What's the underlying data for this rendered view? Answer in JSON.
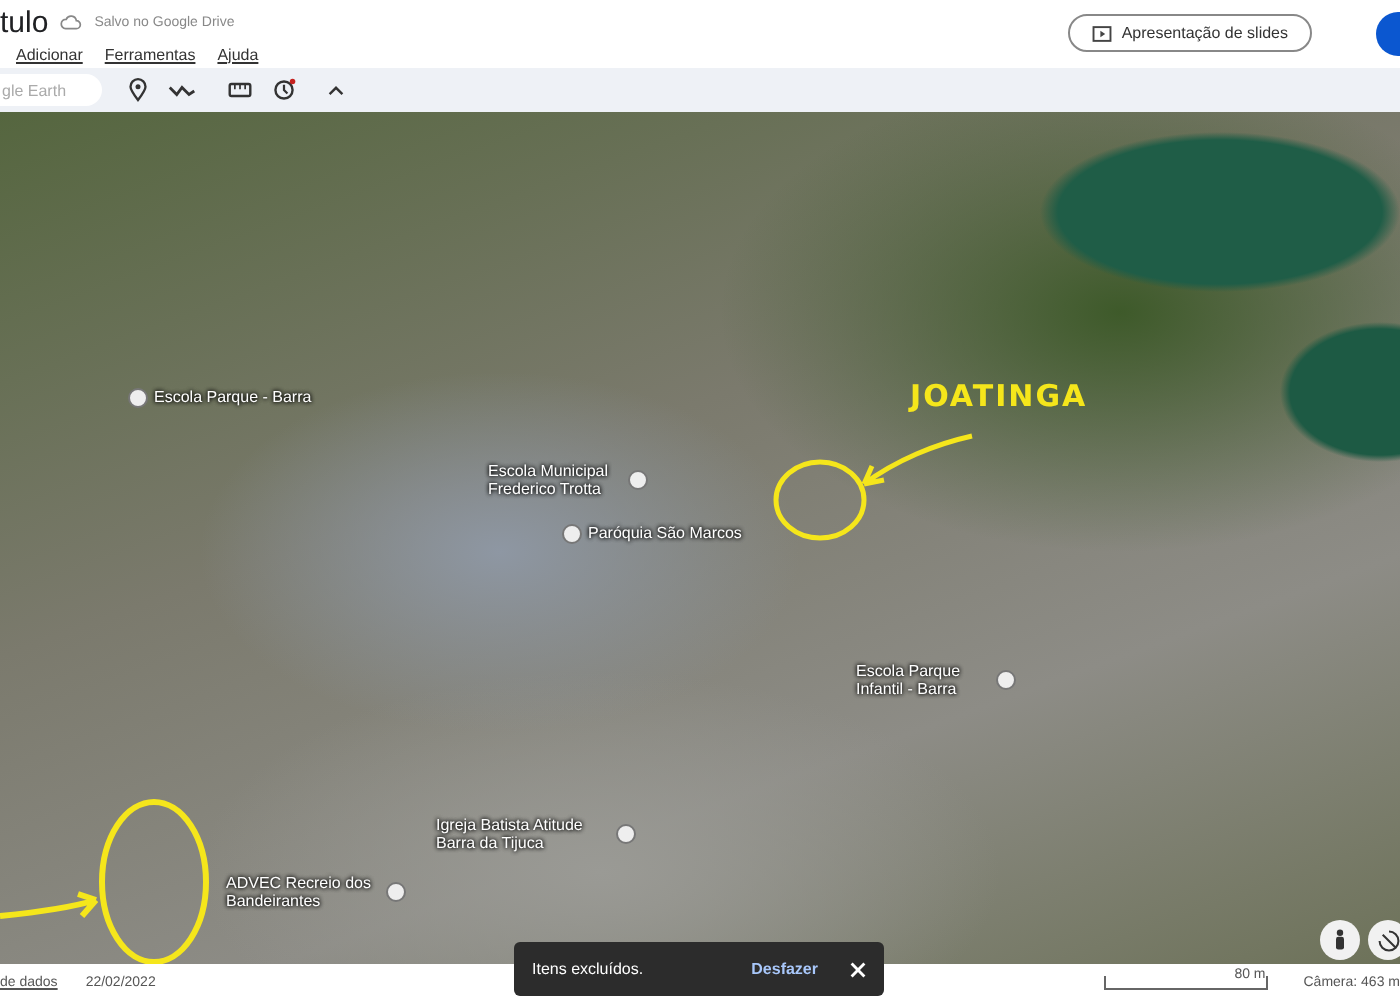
{
  "document": {
    "title": "tulo",
    "save_status": "Salvo no Google Drive"
  },
  "menu": [
    "Adicionar",
    "Ferramentas",
    "Ajuda"
  ],
  "search": {
    "placeholder": "gle Earth"
  },
  "slideshow_button": {
    "label": "Apresentação de slides"
  },
  "map": {
    "labels": [
      {
        "text": "Escola Parque - Barra"
      },
      {
        "text": "Escola Municipal Frederico Trotta"
      },
      {
        "text": "Paróquia São Marcos"
      },
      {
        "text": "Escola Parque Infantil - Barra"
      },
      {
        "text": "Igreja Batista Atitude Barra da Tijuca"
      },
      {
        "text": "ADVEC Recreio dos Bandeirantes"
      }
    ],
    "annotation": "JOATINGA"
  },
  "snackbar": {
    "message": "Itens excluídos.",
    "action": "Desfazer"
  },
  "status_bar": {
    "data_link": "de dados",
    "date": "22/02/2022",
    "scale": "80 m",
    "camera": "Câmera: 463 m"
  }
}
